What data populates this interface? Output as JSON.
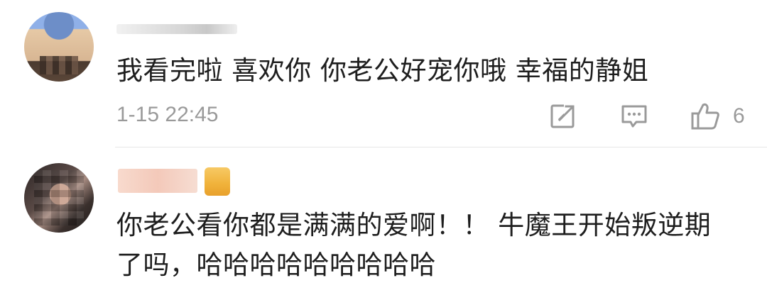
{
  "comments": [
    {
      "text": "我看完啦 喜欢你 你老公好宠你哦 幸福的静姐",
      "timestamp": "1-15 22:45",
      "likes": "6",
      "icons": [
        "share-icon",
        "reply-icon",
        "like-icon"
      ]
    },
    {
      "text_line1": "你老公看你都是满满的爱啊！！ 牛魔王开始叛逆期",
      "text_line2": "了吗，哈哈哈哈哈哈哈哈哈"
    }
  ],
  "colors": {
    "text": "#1e1e1e",
    "meta": "#9a9a9a",
    "divider": "#e6e6e6",
    "vip_badge": "#f0b23a"
  }
}
